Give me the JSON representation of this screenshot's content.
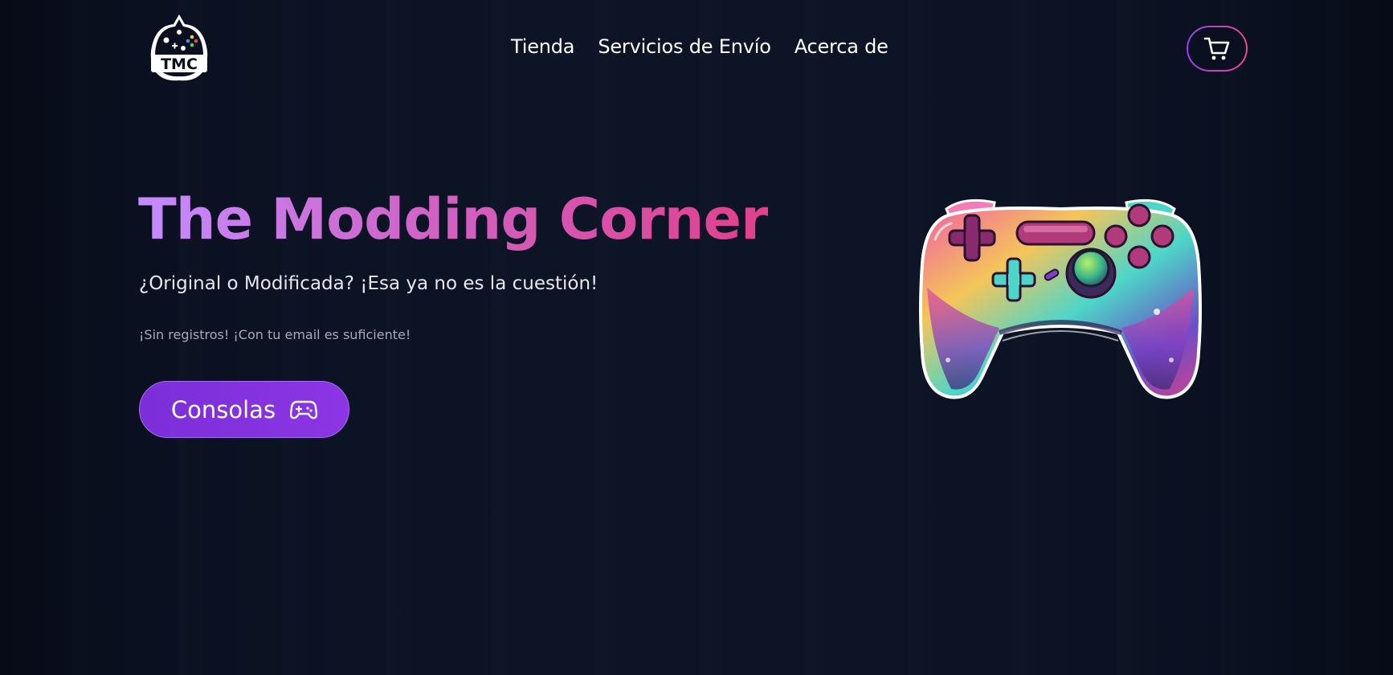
{
  "header": {
    "logo_text": "TMC",
    "nav": [
      {
        "label": "Tienda"
      },
      {
        "label": "Servicios de Envío"
      },
      {
        "label": "Acerca de"
      }
    ],
    "cart_icon": "cart-icon"
  },
  "hero": {
    "title": "The Modding Corner",
    "subtitle": "¿Original o Modificada? ¡Esa ya no es la cuestión!",
    "note": "¡Sin registros! ¡Con tu email es suficiente!",
    "cta_label": "Consolas",
    "cta_icon": "gamepad-icon",
    "illustration": "colorful-gamepad-illustration"
  },
  "colors": {
    "background": "#0b1020",
    "accent_purple": "#8c35e4",
    "accent_pink": "#e0408c",
    "title_gradient_start": "#c48cff"
  }
}
